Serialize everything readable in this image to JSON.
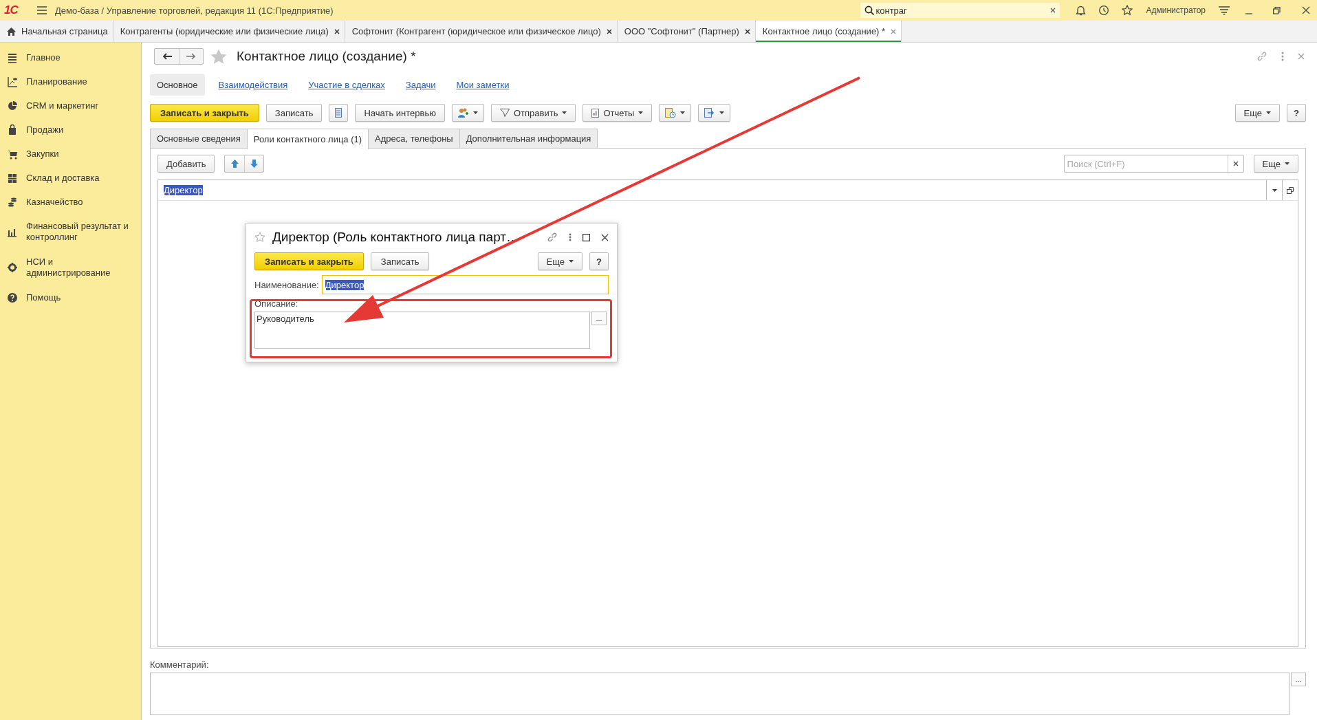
{
  "window": {
    "logo": "1С",
    "title": "Демо-база / Управление торговлей, редакция 11  (1С:Предприятие)",
    "search_value": "контраг",
    "user": "Администратор"
  },
  "open_tabs": [
    {
      "label": "Начальная страница",
      "kind": "home",
      "selected": false
    },
    {
      "label": "Контрагенты (юридические или физические лица)",
      "kind": "document",
      "selected": false
    },
    {
      "label": "Софтонит (Контрагент (юридическое или физическое лицо)",
      "kind": "document",
      "selected": false
    },
    {
      "label": "ООО \"Софтонит\" (Партнер)",
      "kind": "document",
      "selected": false
    },
    {
      "label": "Контактное лицо (создание) *",
      "kind": "document",
      "selected": true
    }
  ],
  "sidebar": {
    "items": [
      {
        "label": "Главное"
      },
      {
        "label": "Планирование"
      },
      {
        "label": "CRM и маркетинг"
      },
      {
        "label": "Продажи"
      },
      {
        "label": "Закупки"
      },
      {
        "label": "Склад и доставка"
      },
      {
        "label": "Казначейство"
      },
      {
        "label": "Финансовый результат и контроллинг"
      },
      {
        "label": "НСИ и администрирование"
      },
      {
        "label": "Помощь"
      }
    ]
  },
  "form": {
    "title": "Контактное лицо (создание) *",
    "nav": [
      {
        "label": "Основное",
        "selected": true
      },
      {
        "label": "Взаимодействия",
        "selected": false
      },
      {
        "label": "Участие в сделках",
        "selected": false
      },
      {
        "label": "Задачи",
        "selected": false
      },
      {
        "label": "Мои заметки",
        "selected": false
      }
    ],
    "toolbar": [
      {
        "kind": "primary",
        "label": "Записать и закрыть"
      },
      {
        "kind": "text",
        "label": "Записать"
      },
      {
        "kind": "icon"
      },
      {
        "kind": "text",
        "label": "Начать интервью"
      },
      {
        "kind": "icon-menu"
      },
      {
        "kind": "menu",
        "label": "Отправить"
      },
      {
        "kind": "menu",
        "label": "Отчеты"
      },
      {
        "kind": "icon-menu"
      },
      {
        "kind": "icon-menu"
      }
    ],
    "more": "Еще",
    "help": "?",
    "tabs": [
      {
        "label": "Основные сведения",
        "selected": false
      },
      {
        "label": "Роли контактного лица (1)",
        "selected": true
      },
      {
        "label": "Адреса, телефоны",
        "selected": false
      },
      {
        "label": "Дополнительная информация",
        "selected": false
      }
    ],
    "list": {
      "add": "Добавить",
      "search_placeholder": "Поиск (Ctrl+F)",
      "more": "Еще",
      "rows": [
        {
          "value": "Директор",
          "selected": true
        }
      ]
    },
    "comment_label": "Комментарий:",
    "comment_button": "..."
  },
  "dialog": {
    "title": "Директор (Роль контактного лица парт…",
    "save_close": "Записать и закрыть",
    "save": "Записать",
    "more": "Еще",
    "help": "?",
    "name_label": "Наименование:",
    "name_value": "Директор",
    "description_label": "Описание:",
    "description_value": "Руководитель",
    "description_button": "..."
  }
}
